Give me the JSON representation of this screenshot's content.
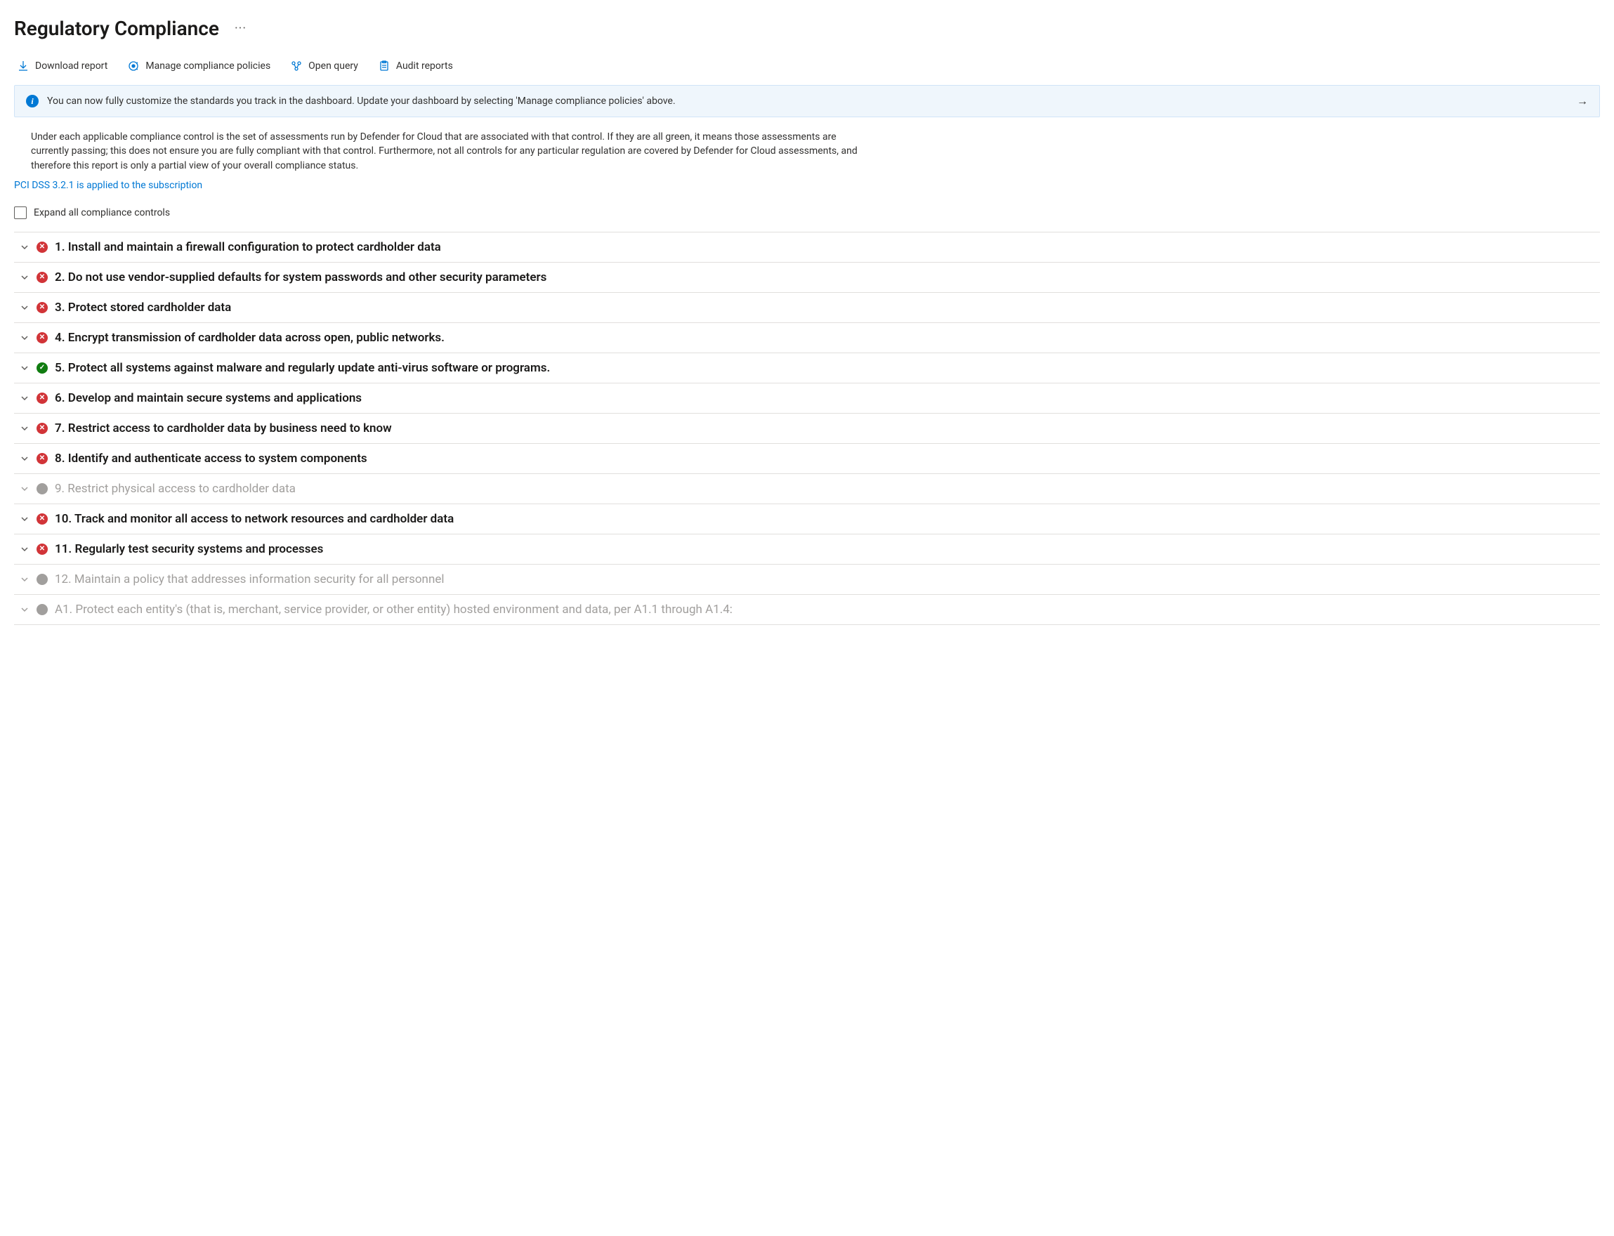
{
  "header": {
    "title": "Regulatory Compliance"
  },
  "toolbar": {
    "download": "Download report",
    "manage": "Manage compliance policies",
    "query": "Open query",
    "audit": "Audit reports"
  },
  "banner": {
    "text": "You can now fully customize the standards you track in the dashboard. Update your dashboard by selecting 'Manage compliance policies' above."
  },
  "description": "Under each applicable compliance control is the set of assessments run by Defender for Cloud that are associated with that control. If they are all green, it means those assessments are currently passing; this does not ensure you are fully compliant with that control. Furthermore, not all controls for any particular regulation are covered by Defender for Cloud assessments, and therefore this report is only a partial view of your overall compliance status.",
  "applied_link": "PCI DSS 3.2.1 is applied to the subscription",
  "expand_all_label": "Expand all compliance controls",
  "controls": [
    {
      "status": "fail",
      "title": "1. Install and maintain a firewall configuration to protect cardholder data"
    },
    {
      "status": "fail",
      "title": "2. Do not use vendor-supplied defaults for system passwords and other security parameters"
    },
    {
      "status": "fail",
      "title": "3. Protect stored cardholder data"
    },
    {
      "status": "fail",
      "title": "4. Encrypt transmission of cardholder data across open, public networks."
    },
    {
      "status": "pass",
      "title": "5. Protect all systems against malware and regularly update anti-virus software or programs."
    },
    {
      "status": "fail",
      "title": "6. Develop and maintain secure systems and applications"
    },
    {
      "status": "fail",
      "title": "7. Restrict access to cardholder data by business need to know"
    },
    {
      "status": "fail",
      "title": "8. Identify and authenticate access to system components"
    },
    {
      "status": "na",
      "title": "9. Restrict physical access to cardholder data"
    },
    {
      "status": "fail",
      "title": "10. Track and monitor all access to network resources and cardholder data"
    },
    {
      "status": "fail",
      "title": "11. Regularly test security systems and processes"
    },
    {
      "status": "na",
      "title": "12. Maintain a policy that addresses information security for all personnel"
    },
    {
      "status": "na",
      "title": "A1. Protect each entity's (that is, merchant, service provider, or other entity) hosted environment and data, per A1.1 through A1.4:"
    }
  ]
}
